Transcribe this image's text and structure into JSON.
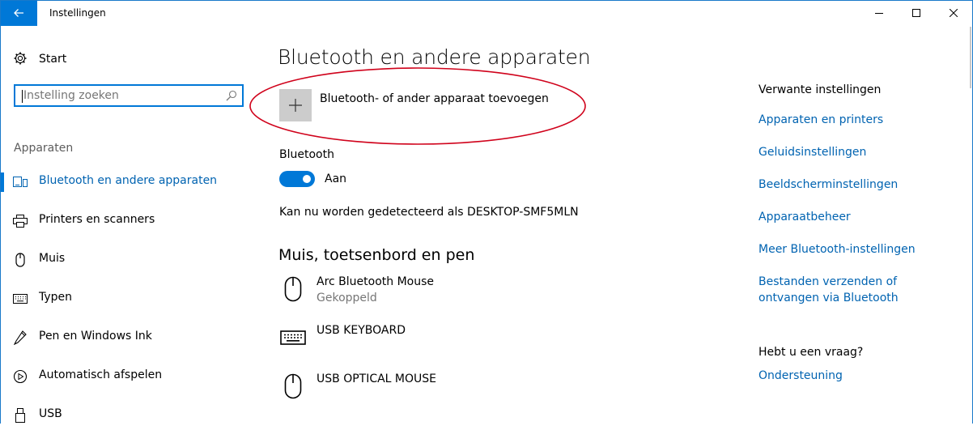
{
  "window": {
    "title": "Instellingen",
    "controls": [
      "minimize",
      "maximize",
      "close"
    ]
  },
  "sidebar": {
    "home_label": "Start",
    "search_placeholder": "Instelling zoeken",
    "section_title": "Apparaten",
    "items": [
      {
        "label": "Bluetooth en andere apparaten",
        "icon": "bluetooth-devices-icon",
        "active": true
      },
      {
        "label": "Printers en scanners",
        "icon": "printer-icon",
        "active": false
      },
      {
        "label": "Muis",
        "icon": "mouse-icon",
        "active": false
      },
      {
        "label": "Typen",
        "icon": "keyboard-icon",
        "active": false
      },
      {
        "label": "Pen en Windows Ink",
        "icon": "pen-icon",
        "active": false
      },
      {
        "label": "Automatisch afspelen",
        "icon": "autoplay-icon",
        "active": false
      },
      {
        "label": "USB",
        "icon": "usb-icon",
        "active": false
      }
    ]
  },
  "main": {
    "title": "Bluetooth en andere apparaten",
    "add_device_label": "Bluetooth- of ander apparaat toevoegen",
    "bluetooth_label": "Bluetooth",
    "bluetooth_state": "Aan",
    "bluetooth_on": true,
    "discoverable_text": "Kan nu worden gedetecteerd als DESKTOP-SMF5MLN",
    "section_title": "Muis, toetsenbord en pen",
    "devices": [
      {
        "name": "Arc Bluetooth Mouse",
        "status": "Gekoppeld",
        "icon": "mouse-icon"
      },
      {
        "name": "USB KEYBOARD",
        "status": "",
        "icon": "keyboard-icon"
      },
      {
        "name": "USB OPTICAL MOUSE",
        "status": "",
        "icon": "mouse-icon"
      }
    ]
  },
  "related": {
    "title": "Verwante instellingen",
    "links": [
      "Apparaten en printers",
      "Geluidsinstellingen",
      "Beeldscherminstellingen",
      "Apparaatbeheer",
      "Meer Bluetooth-instellingen",
      "Bestanden verzenden of ontvangen via Bluetooth"
    ],
    "help_title": "Hebt u een vraag?",
    "help_link": "Ondersteuning"
  },
  "colors": {
    "accent": "#0078d7",
    "link": "#0063b1",
    "annotation_ellipse": "#d0021b"
  }
}
